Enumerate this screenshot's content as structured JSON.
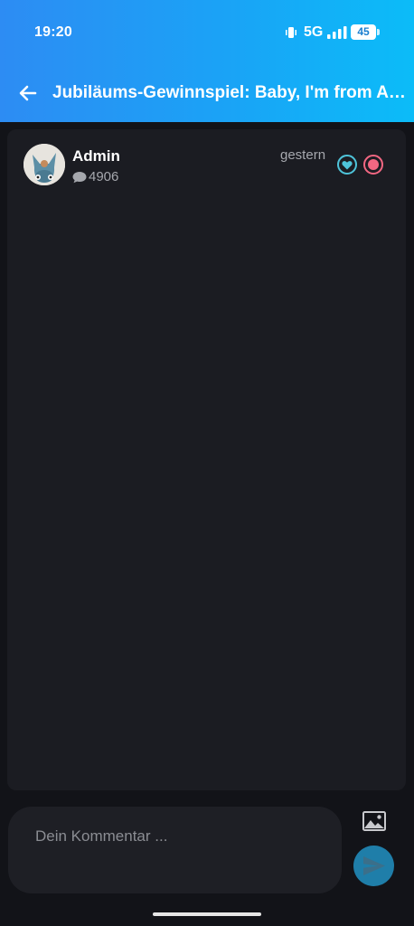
{
  "status_bar": {
    "time": "19:20",
    "network": "5G",
    "battery": "45"
  },
  "header": {
    "title": "Jubiläums-Gewinnspiel: Baby, I'm from Au…"
  },
  "post": {
    "author": "Admin",
    "comment_count": "4906",
    "date": "gestern"
  },
  "composer": {
    "placeholder": "Dein Kommentar ..."
  },
  "colors": {
    "header_gradient_start": "#2d8cf3",
    "header_gradient_end": "#0bbcf8",
    "card": "#1b1c22",
    "send_button": "#1f7ea9",
    "heart_reaction": "#4ec3d9",
    "dot_reaction": "#f36782"
  },
  "icons": {
    "back": "arrow-left-icon",
    "comment": "speech-bubble-icon",
    "heart": "heart-icon",
    "image": "image-icon",
    "send": "send-icon"
  }
}
